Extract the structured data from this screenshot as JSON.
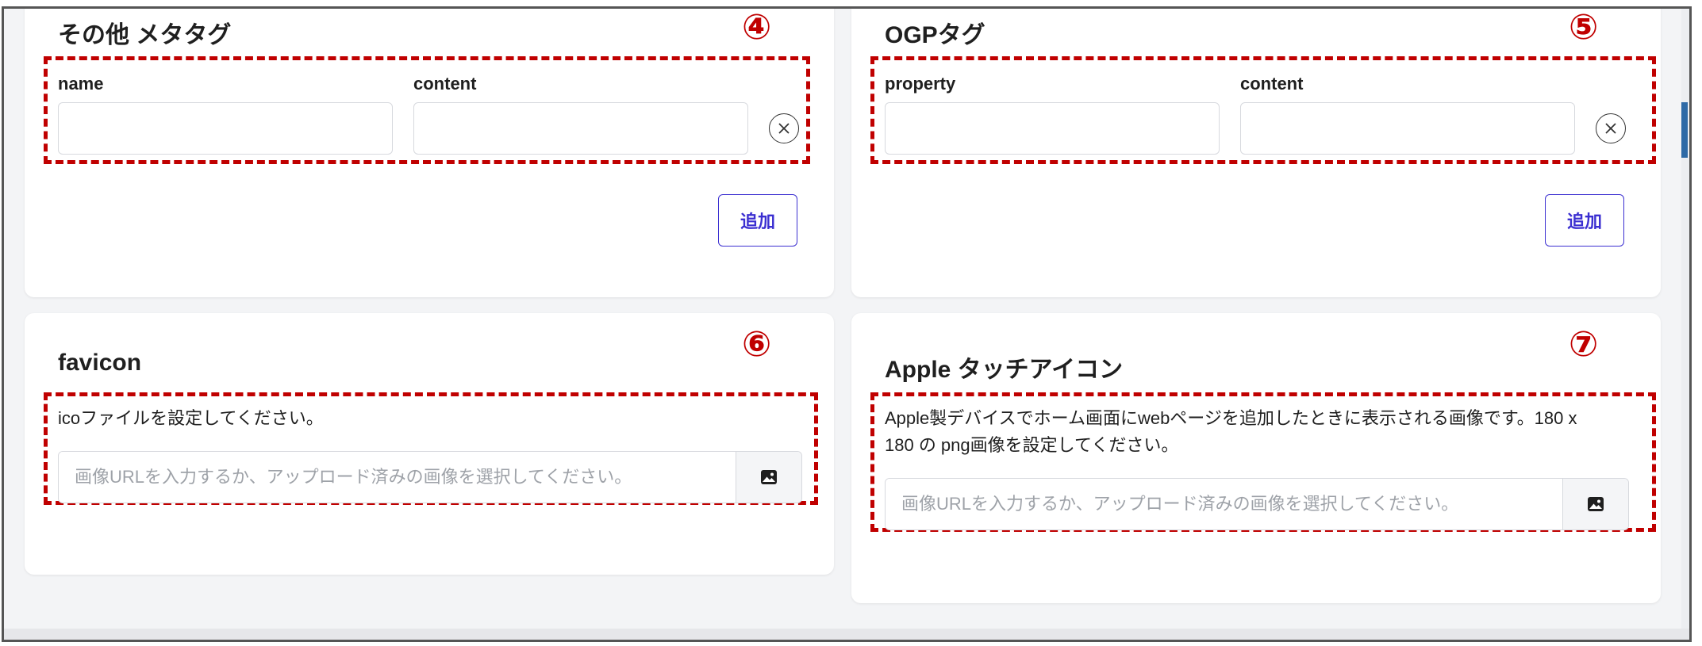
{
  "meta_tags": {
    "title": "その他 メタタグ",
    "marker": "④",
    "name_label": "name",
    "content_label": "content",
    "name_value": "",
    "content_value": "",
    "add_label": "追加"
  },
  "ogp_tags": {
    "title": "OGPタグ",
    "marker": "⑤",
    "property_label": "property",
    "content_label": "content",
    "property_value": "",
    "content_value": "",
    "add_label": "追加"
  },
  "favicon": {
    "title": "favicon",
    "marker": "⑥",
    "description": "icoファイルを設定してください。",
    "placeholder": "画像URLを入力するか、アップロード済みの画像を選択してください。",
    "value": ""
  },
  "apple_touch_icon": {
    "title": "Apple タッチアイコン",
    "marker": "⑦",
    "description_line1": "Apple製デバイスでホーム画面にwebページを追加したときに表示される画像です。180 x",
    "description_line2": "180 の png画像を設定してください。",
    "placeholder": "画像URLを入力するか、アップロード済みの画像を選択してください。",
    "value": ""
  },
  "icons": {
    "clear": "close-circle-icon",
    "image": "image-icon"
  },
  "colors": {
    "annotation": "#c00000",
    "accent": "#3b2fd1"
  }
}
